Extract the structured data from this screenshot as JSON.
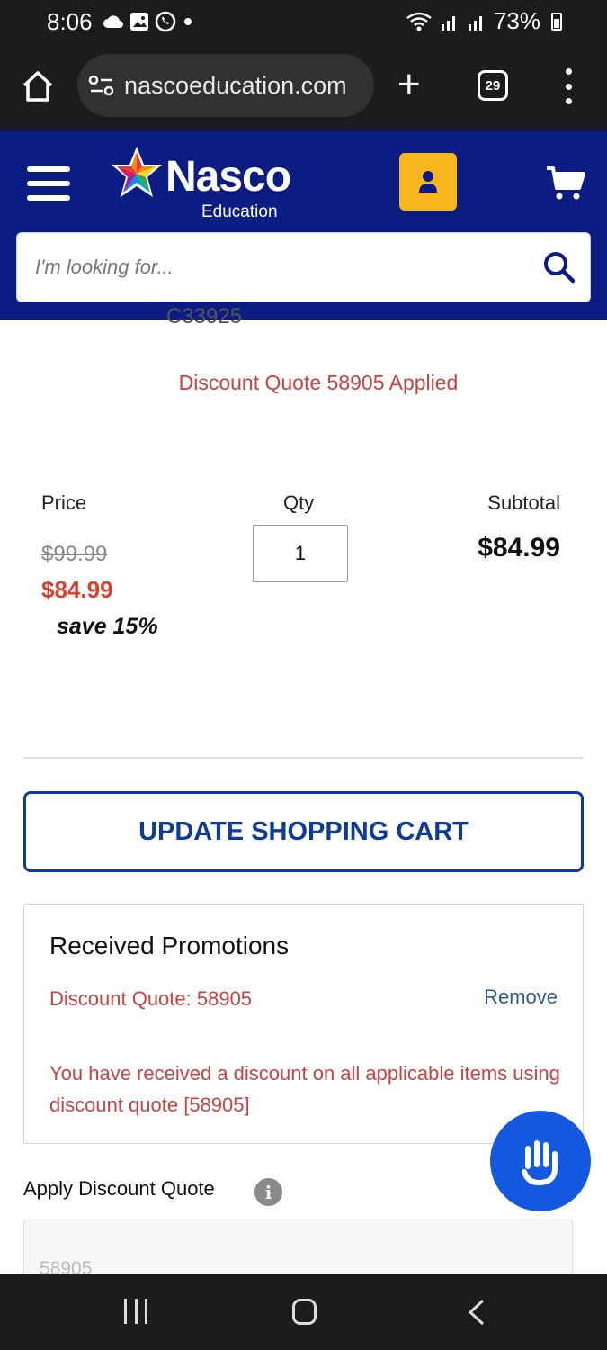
{
  "status_bar": {
    "time": "8:06",
    "battery": "73%"
  },
  "browser": {
    "url": "nascoeducation.com",
    "tab_count": "29"
  },
  "header": {
    "brand_name": "Nasco",
    "brand_sub": "Education",
    "brand_color": "#0b1d83",
    "account_color": "#f7b51e",
    "search_placeholder": "I'm looking for..."
  },
  "cart_item": {
    "sku_partial": "C33925",
    "discount_notice": "Discount Quote 58905 Applied",
    "price_label": "Price",
    "qty_label": "Qty",
    "subtotal_label": "Subtotal",
    "original_price": "$99.99",
    "sale_price": "$84.99",
    "savings": "save 15%",
    "quantity": "1",
    "subtotal": "$84.99"
  },
  "update_cart_label": "UPDATE SHOPPING CART",
  "promotions": {
    "title": "Received Promotions",
    "code_label": "Discount Quote: 58905",
    "remove_label": "Remove",
    "message": "You have received a discount on all applicable items using discount quote [58905]"
  },
  "apply_discount": {
    "label": "Apply Discount Quote",
    "info_glyph": "i",
    "value": "58905"
  }
}
